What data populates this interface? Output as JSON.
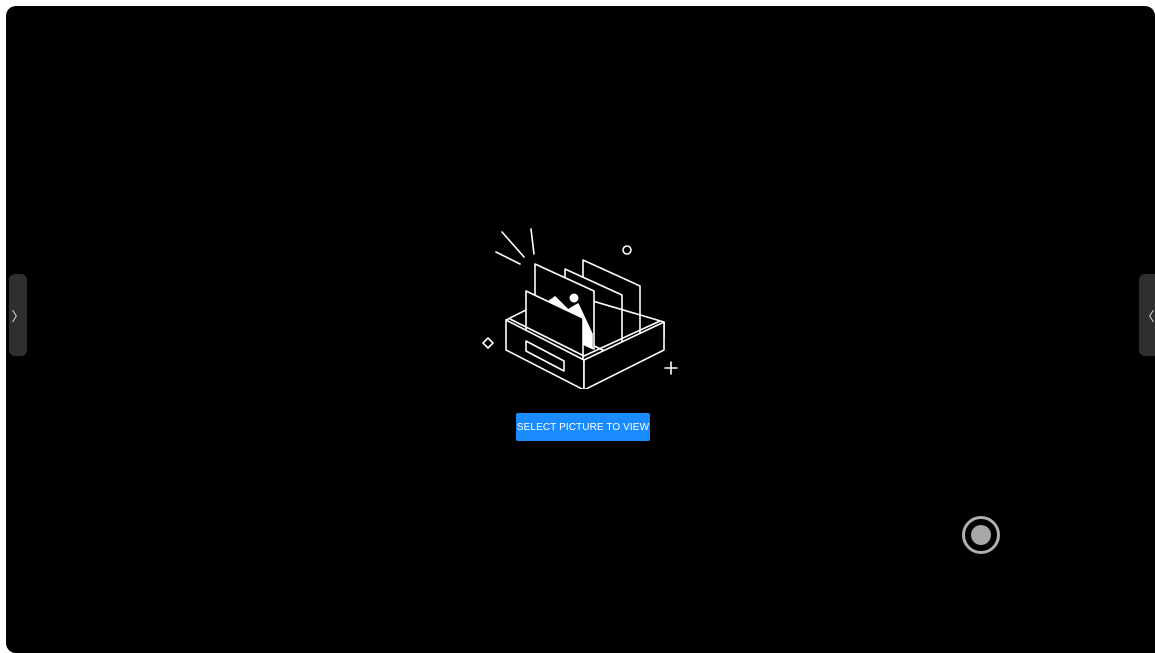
{
  "navigation": {
    "left_handle_glyph": "〉",
    "right_handle_glyph": "〈"
  },
  "empty_state": {
    "illustration_icon": "photo-drawer-icon",
    "button_label": "SELECT PICTURE TO VIEW"
  },
  "controls": {
    "capture_icon": "record-icon"
  },
  "colors": {
    "background": "#000000",
    "accent": "#1a8cff",
    "handle": "#2f2f2f",
    "line_art": "#ffffff"
  }
}
